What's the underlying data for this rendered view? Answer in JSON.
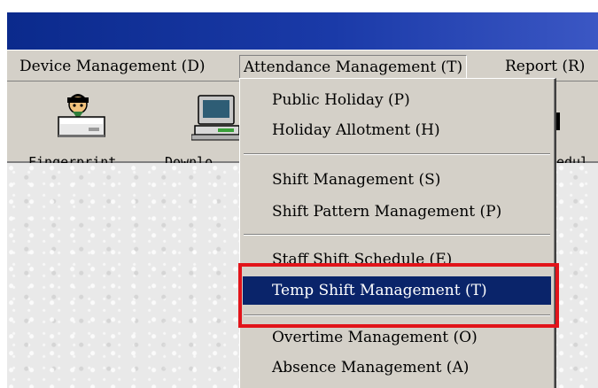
{
  "menubar": {
    "items": [
      {
        "label": "Device Management (D)"
      },
      {
        "label": "Attendance Management (T)"
      },
      {
        "label": "Report (R)"
      }
    ]
  },
  "toolbar": {
    "buttons": [
      {
        "label": "Fingerprint",
        "icon": "fingerprint-device-icon"
      },
      {
        "label": "Downlo",
        "icon": "download-computer-icon"
      },
      {
        "label": "edul",
        "icon": "schedule-icon"
      }
    ]
  },
  "dropdown": {
    "items": [
      {
        "label": "Public Holiday (P)"
      },
      {
        "label": "Holiday Allotment (H)"
      },
      {
        "label": "Shift Management (S)"
      },
      {
        "label": "Shift Pattern Management (P)"
      },
      {
        "label": "Staff Shift Schedule (E)"
      },
      {
        "label": "Temp Shift Management (T)"
      },
      {
        "label": "Overtime Management (O)"
      },
      {
        "label": "Absence Management (A)"
      }
    ],
    "selected_label": "Temp Shift Management (T)"
  },
  "colors": {
    "title_bar": "#0b2a8c",
    "menu_background": "#d4d0c8",
    "selection": "#0a246a",
    "annotation_box": "#e2141a"
  }
}
